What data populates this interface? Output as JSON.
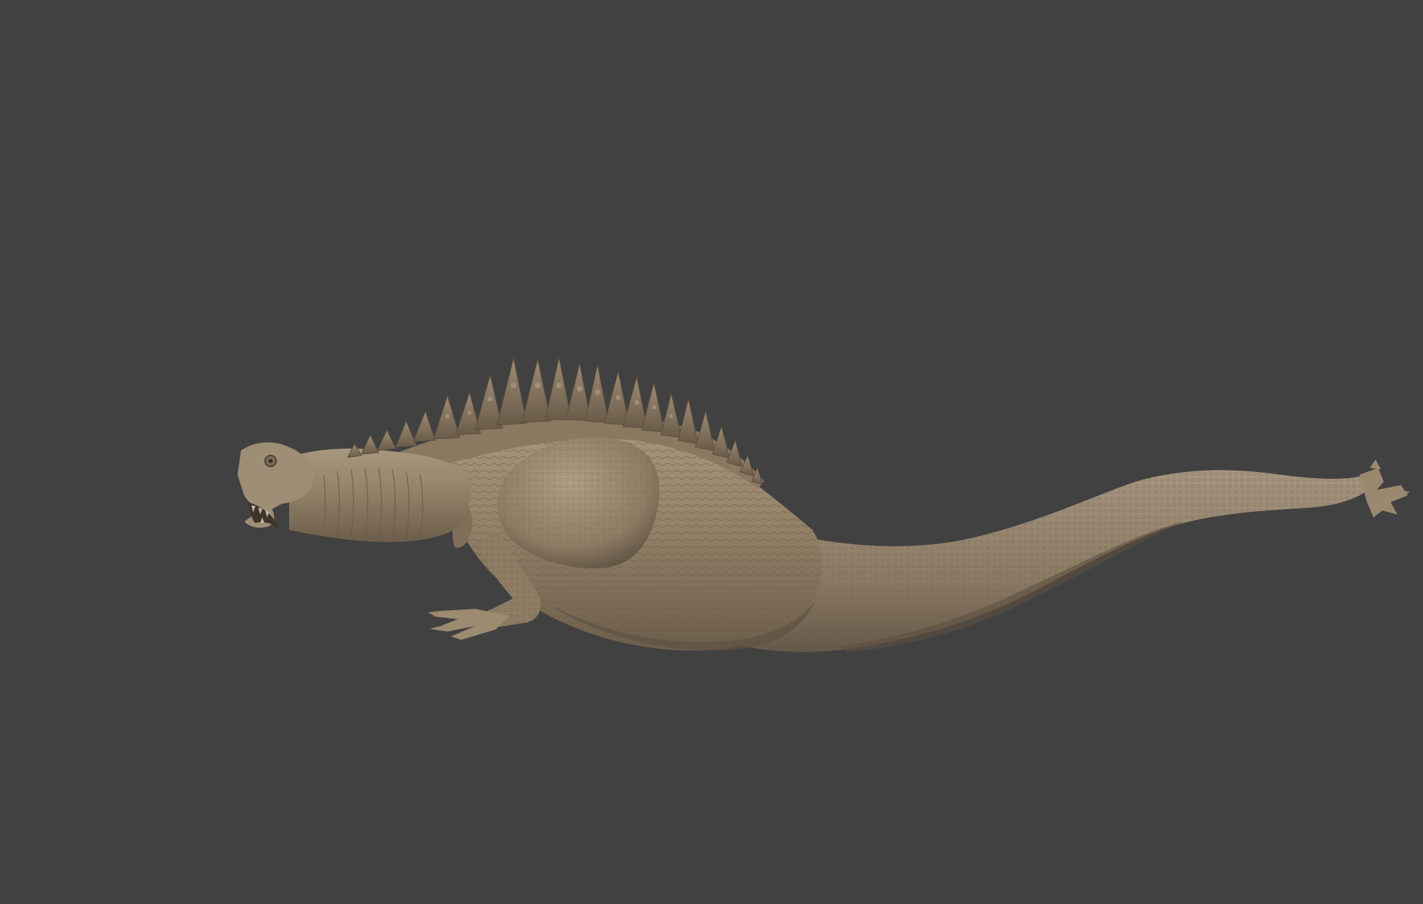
{
  "viewport": {
    "background_color": "#414141"
  },
  "model": {
    "subject": "creature-sculpt",
    "material_color": "#8f7e69",
    "highlight_color": "#b3a38c",
    "shadow_color": "#5d5040",
    "dark_color": "#3a3128"
  }
}
